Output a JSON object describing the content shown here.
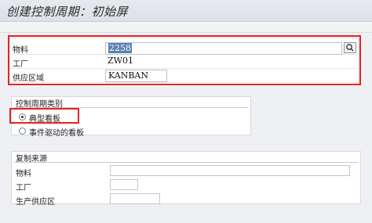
{
  "window": {
    "title": "创建控制周期：初始屏"
  },
  "main_fields": {
    "material": {
      "label": "物料",
      "value": "2258"
    },
    "plant": {
      "label": "工厂",
      "value": "ZW01"
    },
    "supply_area": {
      "label": "供应区域",
      "value": "KANBAN"
    }
  },
  "cycle_category": {
    "title": "控制周期类别",
    "options": [
      {
        "label": "典型看板",
        "selected": true
      },
      {
        "label": "事件驱动的看板",
        "selected": false
      }
    ]
  },
  "copy_from": {
    "title": "复制来源",
    "material_label": "物料",
    "plant_label": "工厂",
    "prod_supply_area_label": "生产供应区"
  },
  "icons": {
    "search": "search-icon"
  },
  "colors": {
    "highlight_border": "#e8231f",
    "selection": "#5b7fb1"
  }
}
